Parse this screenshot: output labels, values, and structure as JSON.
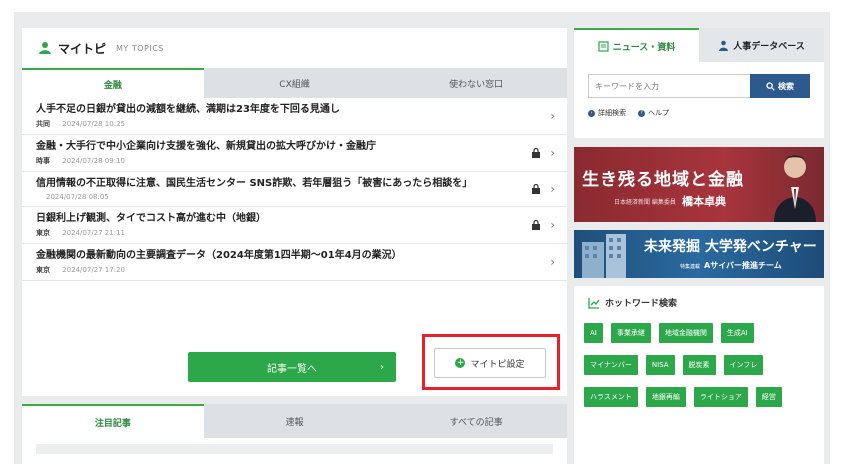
{
  "mytopics": {
    "title": "マイトピ",
    "subtitle": "MY TOPICS",
    "tabs": [
      "金融",
      "CX組織",
      "使わない窓口"
    ],
    "articles": [
      {
        "title": "人手不足の日銀が貸出の減額を継続、満期は23年度を下回る見通し",
        "source": "共同",
        "date": "2024/07/28 10:25",
        "locked": false
      },
      {
        "title": "金融・大手行で中小企業向け支援を強化、新規貸出の拡大呼びかけ・金融庁",
        "source": "時事",
        "date": "2024/07/28 09:10",
        "locked": true
      },
      {
        "title": "信用情報の不正取得に注意、国民生活センター SNS詐欺、若年層狙う「被害にあったら相談を」",
        "source": "",
        "date": "2024/07/28 08:05",
        "locked": true
      },
      {
        "title": "日銀利上げ観測、タイでコスト高が進む中（地銀）",
        "source": "東京",
        "date": "2024/07/27 21:11",
        "locked": true
      },
      {
        "title": "金融機関の最新動向の主要調査データ（2024年度第1四半期〜01年4月の業況）",
        "source": "東京",
        "date": "2024/07/27 17:20",
        "locked": false
      }
    ],
    "more_button": "記事一覧へ",
    "settings_button": "マイトピ設定"
  },
  "bottom": {
    "tabs": [
      "注目記事",
      "速報",
      "すべての記事"
    ]
  },
  "search": {
    "tab_news": "ニュース・資料",
    "tab_hr": "人事データベース",
    "placeholder": "キーワードを入力",
    "button": "検索",
    "link_detail": "詳細検索",
    "link_help": "ヘルプ"
  },
  "banner1": {
    "headline": "生き残る地域と金融",
    "sub": "日本経済新聞 編集委員",
    "name": "橋本卓典"
  },
  "banner2": {
    "headline": "未来発掘 大学発ベンチャー",
    "sub_small": "特集連載",
    "sub": "Aサイバー推進チーム"
  },
  "hotword": {
    "title": "ホットワード検索",
    "chips": [
      "AI",
      "事業承継",
      "地域金融機関",
      "生成AI",
      "マイナンバー",
      "NISA",
      "脱炭素",
      "インフレ",
      "ハラスメント",
      "地銀再編",
      "ライトショア",
      "経営"
    ]
  }
}
